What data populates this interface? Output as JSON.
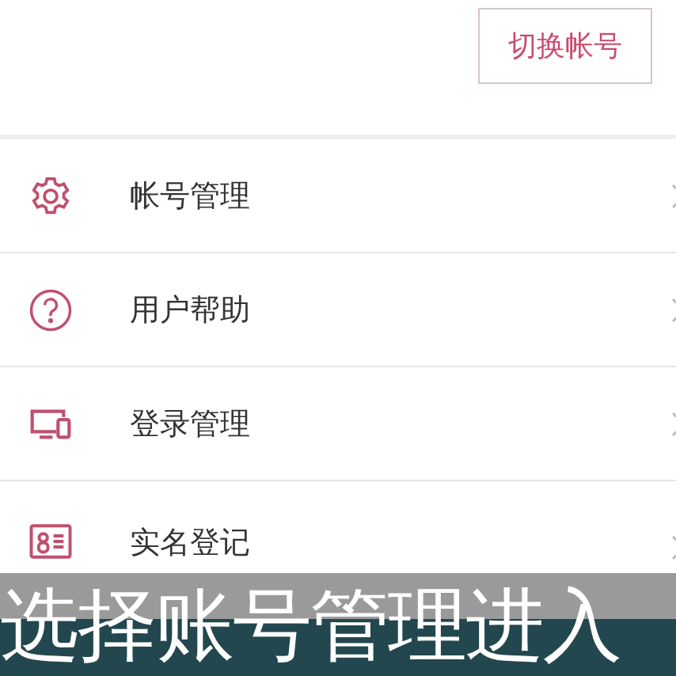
{
  "switch_account_button": "切换帐号",
  "menu_items": [
    {
      "label": "帐号管理"
    },
    {
      "label": "用户帮助"
    },
    {
      "label": "登录管理"
    },
    {
      "label": "实名登记"
    }
  ],
  "subtitle": "选择账号管理进入"
}
